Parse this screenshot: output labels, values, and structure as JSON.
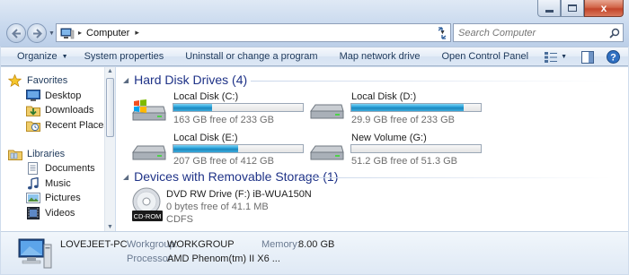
{
  "window": {
    "caption_buttons": [
      "minimize",
      "maximize",
      "close"
    ],
    "close_glyph": "x"
  },
  "address_bar": {
    "location": "Computer",
    "chevron": "▸"
  },
  "search": {
    "placeholder": "Search Computer"
  },
  "command_bar": {
    "items": [
      {
        "label": "Organize",
        "has_dropdown": true
      },
      {
        "label": "System properties"
      },
      {
        "label": "Uninstall or change a program"
      },
      {
        "label": "Map network drive"
      },
      {
        "label": "Open Control Panel"
      }
    ]
  },
  "nav_pane": {
    "favorites": {
      "label": "Favorites",
      "items": [
        {
          "label": "Desktop",
          "icon": "desktop-icon"
        },
        {
          "label": "Downloads",
          "icon": "downloads-icon"
        },
        {
          "label": "Recent Places",
          "icon": "recent-places-icon"
        }
      ]
    },
    "libraries": {
      "label": "Libraries",
      "items": [
        {
          "label": "Documents",
          "icon": "documents-icon"
        },
        {
          "label": "Music",
          "icon": "music-icon"
        },
        {
          "label": "Pictures",
          "icon": "pictures-icon"
        },
        {
          "label": "Videos",
          "icon": "videos-icon"
        }
      ]
    }
  },
  "content": {
    "hard_disk_group": {
      "title": "Hard Disk Drives (4)",
      "drives": [
        {
          "name": "Local Disk (C:)",
          "free": "163 GB free of 233 GB",
          "used_fraction": 0.3,
          "os_drive": true
        },
        {
          "name": "Local Disk (D:)",
          "free": "29.9 GB free of 233 GB",
          "used_fraction": 0.87,
          "os_drive": false
        },
        {
          "name": "Local Disk (E:)",
          "free": "207 GB free of 412 GB",
          "used_fraction": 0.5,
          "os_drive": false
        },
        {
          "name": "New Volume (G:)",
          "free": "51.2 GB free of 51.3 GB",
          "used_fraction": 0.002,
          "os_drive": false
        }
      ]
    },
    "removable_group": {
      "title": "Devices with Removable Storage (1)",
      "device": {
        "name": "DVD RW Drive (F:) iB-WUA150N",
        "free": "0 bytes free of 41.1 MB",
        "filesystem": "CDFS",
        "icon_label": "CD-ROM"
      }
    }
  },
  "details": {
    "computer_name": "LOVEJEET-PC",
    "workgroup_label": "Workgroup:",
    "workgroup_value": "WORKGROUP",
    "memory_label": "Memory:",
    "memory_value": "8.00 GB",
    "processor_label": "Processor:",
    "processor_value": "AMD Phenom(tm) II X6 ..."
  },
  "colors": {
    "accent_bar": "#26a0da",
    "group_title": "#1e3287",
    "command_text": "#1e395b",
    "frame": "#cfdcec"
  }
}
